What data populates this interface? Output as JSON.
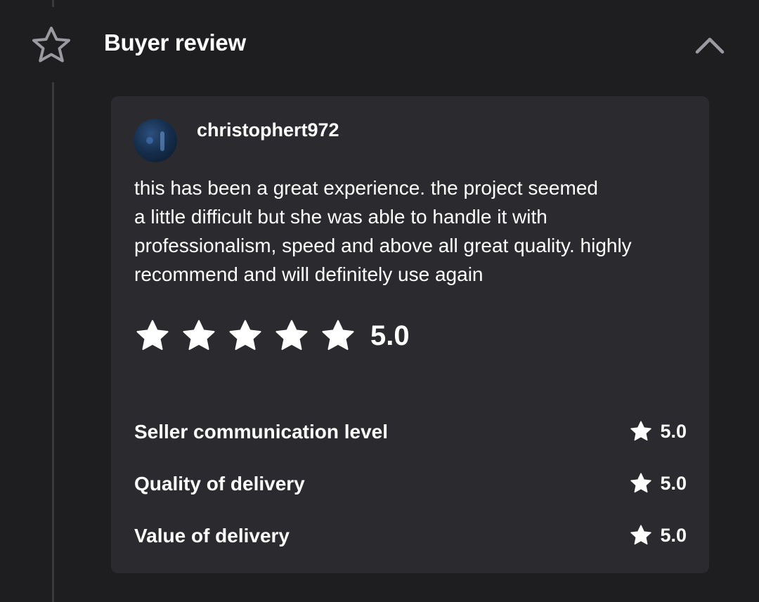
{
  "section": {
    "title": "Buyer review",
    "icon": "star-outline-icon",
    "toggle_icon": "chevron-up-icon"
  },
  "review": {
    "username": "christophert972",
    "text": "this has been a great experience.  the project seemed\na little difficult but she was able to handle it with\nprofessionalism, speed and above all great quality. highly\nrecommend and will definitely use again",
    "overall_rating": "5.0",
    "stars_filled": 5,
    "stars_total": 5,
    "breakdown": [
      {
        "label": "Seller communication level",
        "score": "5.0"
      },
      {
        "label": "Quality of delivery",
        "score": "5.0"
      },
      {
        "label": "Value of delivery",
        "score": "5.0"
      }
    ]
  },
  "colors": {
    "background": "#1e1e20",
    "card": "#2b2b2f",
    "text": "#ffffff",
    "icon_outline": "#9a9aa0"
  }
}
